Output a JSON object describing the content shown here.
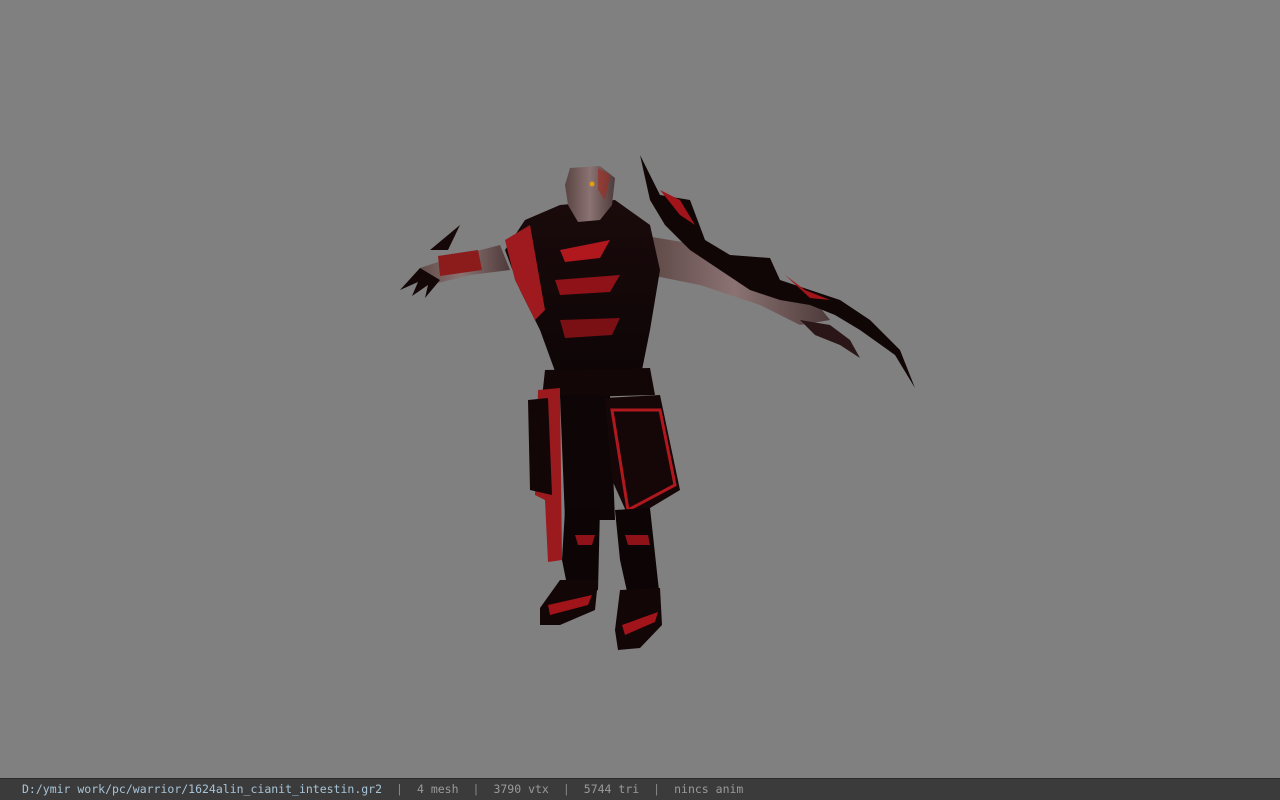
{
  "window": {
    "background": "#808080"
  },
  "viewport": {
    "model_name": "warrior-character-model"
  },
  "status": {
    "file_path": "D:/ymir work/pc/warrior/1624alin_cianit_intestin.gr2",
    "mesh": "4 mesh",
    "vtx": "3790 vtx",
    "tri": "5744 tri",
    "anim": "nincs anim",
    "separator": "|"
  }
}
